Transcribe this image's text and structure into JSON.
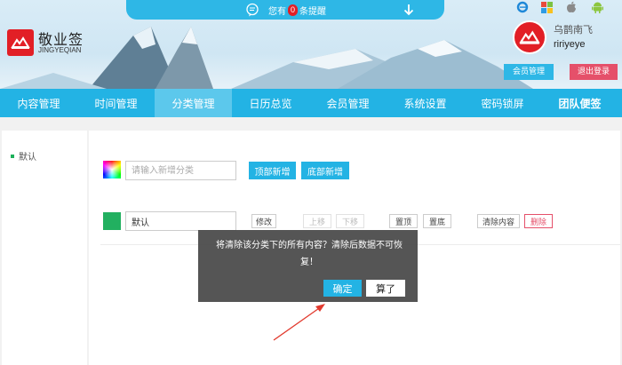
{
  "header": {
    "logo_title": "敬业签",
    "logo_subtitle": "JINGYEQIAN",
    "notice_prefix": "您有",
    "notice_count": "0",
    "notice_suffix": "条提醒",
    "platform_icons": [
      "ie-icon",
      "windows-icon",
      "apple-icon",
      "android-icon"
    ],
    "user_name": "乌鹊南飞",
    "user_id": "ririyeye",
    "member_btn": "会员管理",
    "logout_btn": "退出登录"
  },
  "nav": {
    "items": [
      {
        "label": "内容管理"
      },
      {
        "label": "时间管理"
      },
      {
        "label": "分类管理"
      },
      {
        "label": "日历总览"
      },
      {
        "label": "会员管理"
      },
      {
        "label": "系统设置"
      },
      {
        "label": "密码锁屏"
      },
      {
        "label": "团队便签"
      }
    ],
    "active_index": 2
  },
  "sidebar": {
    "items": [
      {
        "label": "默认"
      }
    ]
  },
  "add_category": {
    "placeholder": "请输入新增分类",
    "top_add_btn": "顶部新增",
    "bottom_add_btn": "底部新增"
  },
  "category_row": {
    "name_value": "默认",
    "edit_btn": "修改",
    "move_up_btn": "上移",
    "move_down_btn": "下移",
    "top_btn": "置顶",
    "bottom_btn": "置底",
    "clear_btn": "清除内容",
    "delete_btn": "删除"
  },
  "dialog": {
    "message": "将清除该分类下的所有内容？清除后数据不可恢复！",
    "ok": "确定",
    "cancel": "算了"
  },
  "colors": {
    "brand_blue": "#23b3e4",
    "brand_red": "#e21f26",
    "logout_pink": "#e5506a",
    "category_green": "#22b060"
  }
}
